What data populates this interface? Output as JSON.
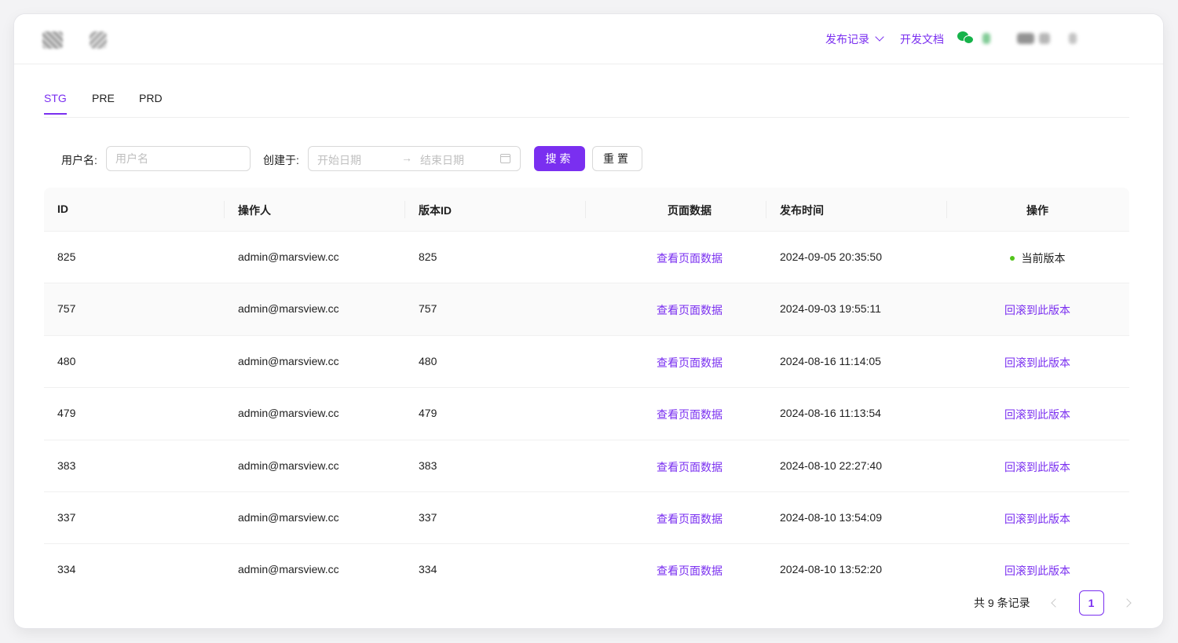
{
  "header": {
    "release_menu": "发布记录",
    "docs_link": "开发文档"
  },
  "tabs": [
    {
      "label": "STG",
      "active": true
    },
    {
      "label": "PRE",
      "active": false
    },
    {
      "label": "PRD",
      "active": false
    }
  ],
  "filter": {
    "username_label": "用户名:",
    "username_placeholder": "用户名",
    "created_label": "创建于:",
    "start_placeholder": "开始日期",
    "end_placeholder": "结束日期",
    "search_button": "搜索",
    "reset_button": "重置"
  },
  "table": {
    "columns": [
      "ID",
      "操作人",
      "版本ID",
      "页面数据",
      "发布时间",
      "操作"
    ],
    "rows": [
      {
        "id": "825",
        "operator": "admin@marsview.cc",
        "version": "825",
        "page": "查看页面数据",
        "time": "2024-09-05 20:35:50",
        "action": "当前版本",
        "current": true
      },
      {
        "id": "757",
        "operator": "admin@marsview.cc",
        "version": "757",
        "page": "查看页面数据",
        "time": "2024-09-03 19:55:11",
        "action": "回滚到此版本",
        "current": false
      },
      {
        "id": "480",
        "operator": "admin@marsview.cc",
        "version": "480",
        "page": "查看页面数据",
        "time": "2024-08-16 11:14:05",
        "action": "回滚到此版本",
        "current": false
      },
      {
        "id": "479",
        "operator": "admin@marsview.cc",
        "version": "479",
        "page": "查看页面数据",
        "time": "2024-08-16 11:13:54",
        "action": "回滚到此版本",
        "current": false
      },
      {
        "id": "383",
        "operator": "admin@marsview.cc",
        "version": "383",
        "page": "查看页面数据",
        "time": "2024-08-10 22:27:40",
        "action": "回滚到此版本",
        "current": false
      },
      {
        "id": "337",
        "operator": "admin@marsview.cc",
        "version": "337",
        "page": "查看页面数据",
        "time": "2024-08-10 13:54:09",
        "action": "回滚到此版本",
        "current": false
      },
      {
        "id": "334",
        "operator": "admin@marsview.cc",
        "version": "334",
        "page": "查看页面数据",
        "time": "2024-08-10 13:52:20",
        "action": "回滚到此版本",
        "current": false
      }
    ]
  },
  "pagination": {
    "total_text": "共 9 条记录",
    "current_page": "1"
  },
  "colors": {
    "accent": "#7a2ff0",
    "status_current": "#52c41a"
  }
}
